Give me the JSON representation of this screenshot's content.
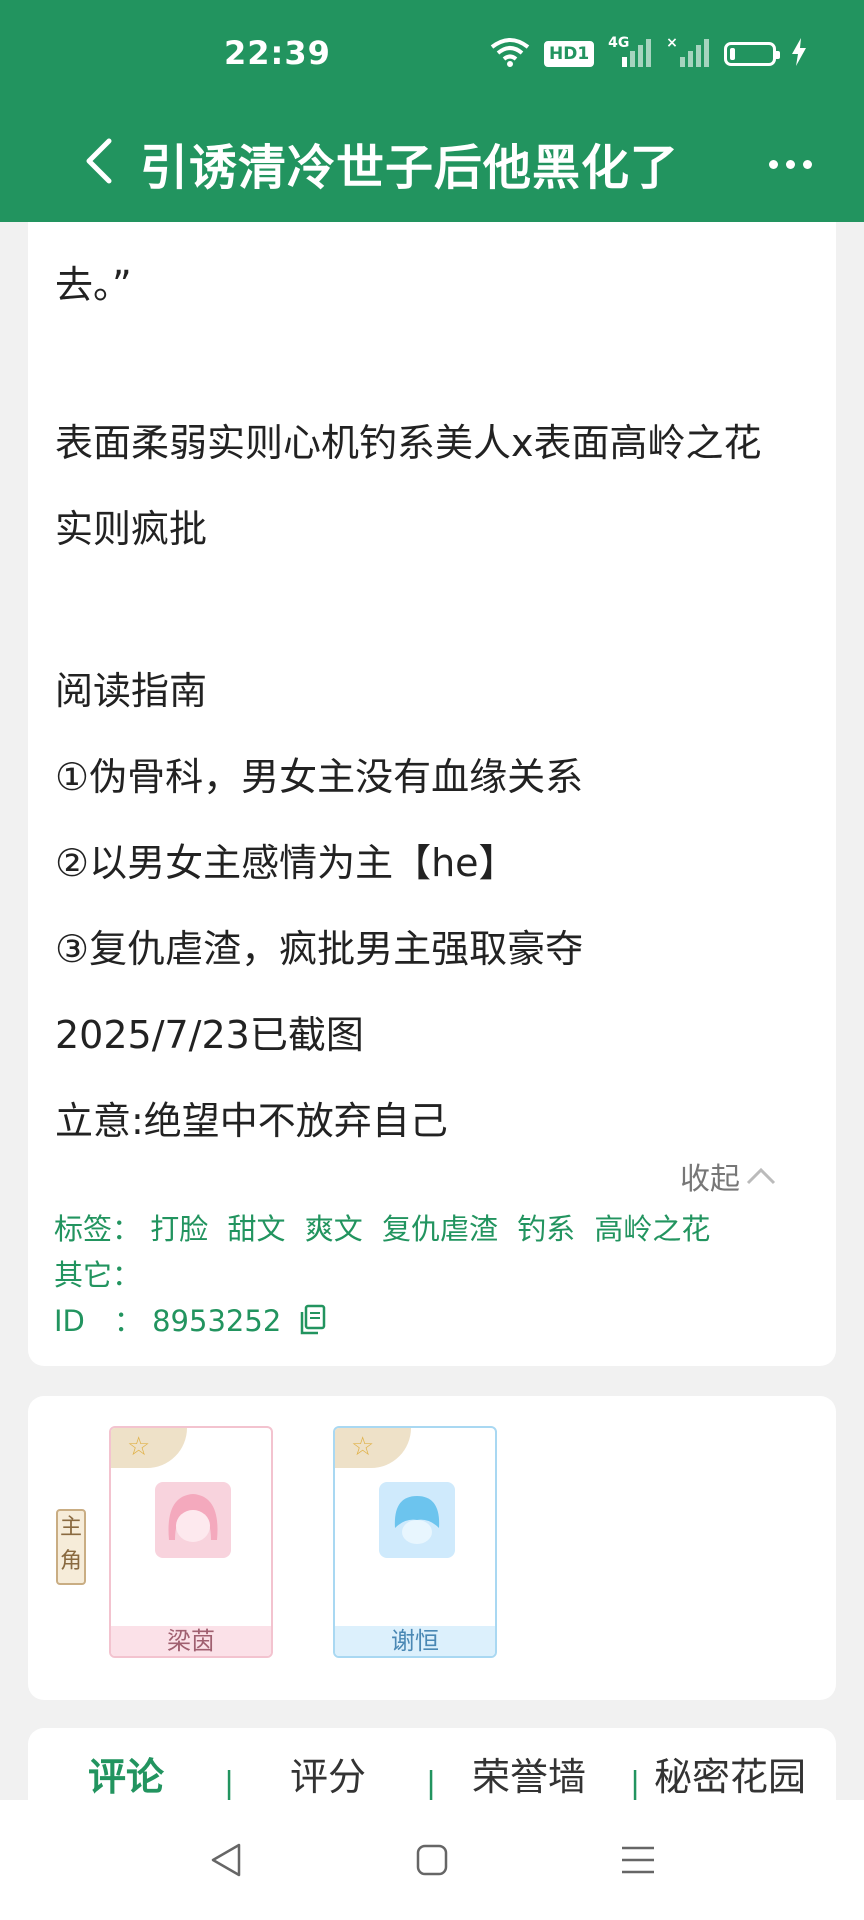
{
  "status_bar": {
    "time": "22:39",
    "hd": "HD1",
    "network": "4G",
    "signal2_mark": "×"
  },
  "nav": {
    "title": "引诱清冷世子后他黑化了"
  },
  "intro": {
    "lines": [
      "去。”",
      "表面柔弱实则心机钓系美人x表面高岭之花",
      "实则疯批",
      "阅读指南",
      "①伪骨科，男女主没有血缘关系",
      "②以男女主感情为主【he】",
      "③复仇虐渣，疯批男主强取豪夺",
      "2025/7/23已截图",
      "立意:绝望中不放弃自己"
    ],
    "collapse_label": "收起",
    "tags_label": "标签：",
    "tags": [
      "打脸",
      "甜文",
      "爽文",
      "复仇虐渣",
      "钓系",
      "高岭之花"
    ],
    "other_label": "其它：",
    "id_label": "ID　：",
    "id_value": "8953252"
  },
  "characters": {
    "role_label": "主角",
    "items": [
      {
        "name": "梁茵"
      },
      {
        "name": "谢恒"
      }
    ]
  },
  "tabs": [
    {
      "label": "评论"
    },
    {
      "label": "评分"
    },
    {
      "label": "荣誉墙"
    },
    {
      "label": "秘密花园"
    }
  ],
  "tab_separator": "|"
}
